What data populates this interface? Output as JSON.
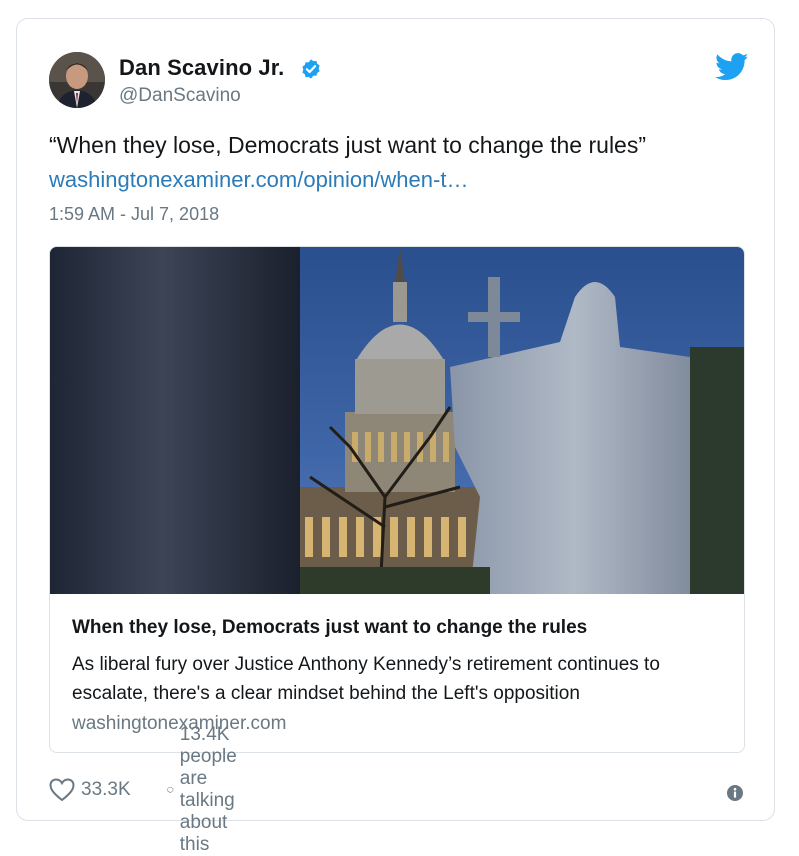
{
  "tweet": {
    "author_name": "Dan Scavino Jr.",
    "author_handle": "@DanScavino",
    "text": "“When they lose, Democrats just want to change the rules”",
    "link_text": "washingtonexaminer.com/opinion/when-t…",
    "timestamp": "1:59 AM - Jul 7, 2018"
  },
  "link_card": {
    "title": "When they lose, Democrats just want to change the rules",
    "description": "As liberal fury over Justice Anthony Kennedy’s retirement continues to escalate, there's a clear mindset behind the Left's opposition",
    "domain": "washingtonexaminer.com"
  },
  "actions": {
    "likes": "33.3K",
    "talking": "13.4K people are talking about this"
  },
  "icons": {
    "verified": "verified-badge-icon",
    "brand": "twitter-bird-icon",
    "like": "heart-icon",
    "reply": "speech-bubble-icon",
    "info": "info-icon"
  },
  "colors": {
    "link": "#2b7bb9",
    "verified": "#1da1f2",
    "secondary_text": "#697882",
    "border": "#dbe1e6"
  }
}
